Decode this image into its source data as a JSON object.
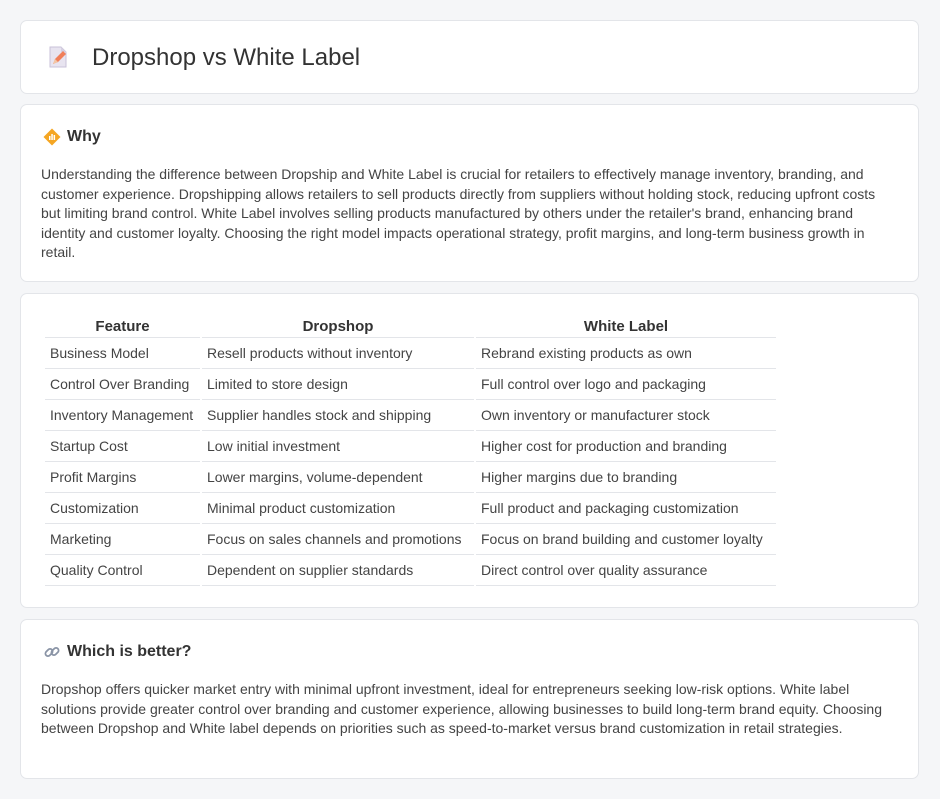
{
  "header": {
    "title": "Dropshop vs White Label",
    "icon": "pencil-document-icon"
  },
  "why": {
    "heading": "Why",
    "icon": "diamond-signal-icon",
    "text": "Understanding the difference between Dropship and White Label is crucial for retailers to effectively manage inventory, branding, and customer experience. Dropshipping allows retailers to sell products directly from suppliers without holding stock, reducing upfront costs but limiting brand control. White Label involves selling products manufactured by others under the retailer's brand, enhancing brand identity and customer loyalty. Choosing the right model impacts operational strategy, profit margins, and long-term business growth in retail."
  },
  "table": {
    "headers": [
      "Feature",
      "Dropshop",
      "White Label"
    ],
    "rows": [
      [
        "Business Model",
        "Resell products without inventory",
        "Rebrand existing products as own"
      ],
      [
        "Control Over Branding",
        "Limited to store design",
        "Full control over logo and packaging"
      ],
      [
        "Inventory Management",
        "Supplier handles stock and shipping",
        "Own inventory or manufacturer stock"
      ],
      [
        "Startup Cost",
        "Low initial investment",
        "Higher cost for production and branding"
      ],
      [
        "Profit Margins",
        "Lower margins, volume-dependent",
        "Higher margins due to branding"
      ],
      [
        "Customization",
        "Minimal product customization",
        "Full product and packaging customization"
      ],
      [
        "Marketing",
        "Focus on sales channels and promotions",
        "Focus on brand building and customer loyalty"
      ],
      [
        "Quality Control",
        "Dependent on supplier standards",
        "Direct control over quality assurance"
      ]
    ]
  },
  "better": {
    "heading": "Which is better?",
    "icon": "link-icon",
    "text": "Dropshop offers quicker market entry with minimal upfront investment, ideal for entrepreneurs seeking low-risk options. White label solutions provide greater control over branding and customer experience, allowing businesses to build long-term brand equity. Choosing between Dropshop and White label depends on priorities such as speed-to-market versus brand customization in retail strategies."
  }
}
